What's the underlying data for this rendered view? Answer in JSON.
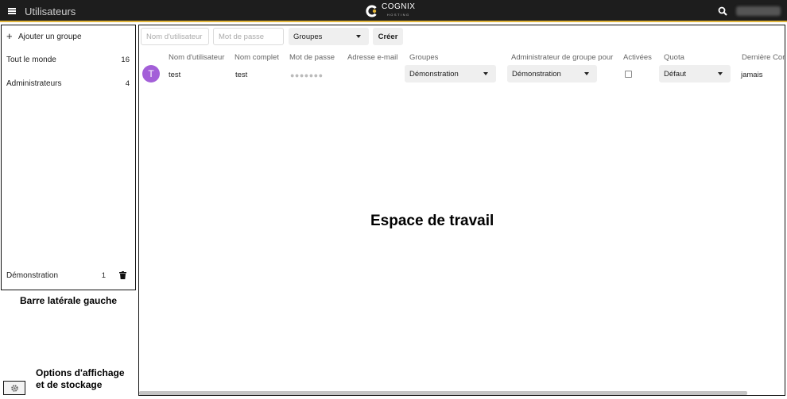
{
  "header": {
    "title": "Utilisateurs",
    "logo_text": "COGNIX",
    "logo_sub": "HOSTING",
    "menu_icon": "hamburger-menu-icon",
    "search_icon": "search-icon",
    "accent_color": "#e0b43a"
  },
  "sidebar": {
    "add_group_label": "Ajouter un groupe",
    "items": [
      {
        "label": "Tout le monde",
        "count": "16"
      },
      {
        "label": "Administrateurs",
        "count": "4"
      },
      {
        "label": "",
        "count": ""
      },
      {
        "label": "",
        "count": ""
      },
      {
        "label": "",
        "count": ""
      },
      {
        "label": "",
        "count": ""
      },
      {
        "label": "",
        "count": ""
      },
      {
        "label": "",
        "count": ""
      },
      {
        "label": "",
        "count": ""
      },
      {
        "label": "Démonstration",
        "count": "1"
      }
    ]
  },
  "annotations": {
    "sidebar": "Barre latérale gauche",
    "options_line1": "Options d'affichage",
    "options_line2": "et de stockage",
    "workspace": "Espace de travail"
  },
  "toolbar": {
    "username_placeholder": "Nom d'utilisateur",
    "password_placeholder": "Mot de passe",
    "groups_select": "Groupes",
    "create_label": "Créer"
  },
  "table": {
    "columns": [
      "Nom d'utilisateur",
      "Nom complet",
      "Mot de passe",
      "Adresse e-mail",
      "Groupes",
      "Administrateur de groupe pour",
      "Activées",
      "Quota",
      "Dernière Connexion"
    ],
    "rows": [
      {
        "avatar": "T",
        "username": "test",
        "fullname": "test",
        "password": "●●●●●●●",
        "email": "",
        "groups": "Démonstration",
        "group_admin": "Démonstration",
        "enabled": false,
        "quota": "Défaut",
        "last_login": "jamais"
      }
    ]
  },
  "colors": {
    "header_bg": "#1d1d1d",
    "avatar_bg": "#a35fd8"
  }
}
